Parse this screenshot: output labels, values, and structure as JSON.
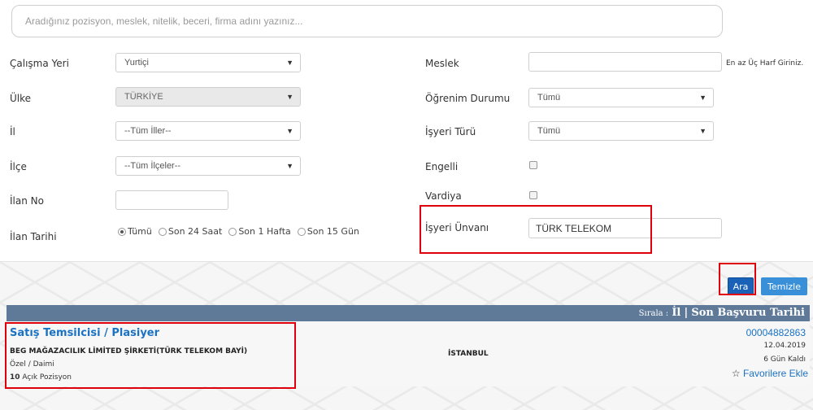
{
  "search": {
    "placeholder": "Aradığınız pozisyon, meslek, nitelik, beceri, firma adını yazınız..."
  },
  "form": {
    "calisma_yeri": {
      "label": "Çalışma Yeri",
      "value": "Yurtiçi"
    },
    "ulke": {
      "label": "Ülke",
      "value": "TÜRKİYE"
    },
    "il": {
      "label": "İl",
      "value": "--Tüm İller--"
    },
    "ilce": {
      "label": "İlçe",
      "value": "--Tüm İlçeler--"
    },
    "ilan_no": {
      "label": "İlan No",
      "value": ""
    },
    "ilan_tarihi": {
      "label": "İlan Tarihi",
      "options": [
        "Tümü",
        "Son 24 Saat",
        "Son 1 Hafta",
        "Son 15 Gün"
      ],
      "selected": "Tümü"
    },
    "meslek": {
      "label": "Meslek",
      "value": "",
      "hint": "En az Üç Harf Giriniz."
    },
    "ogrenim_durumu": {
      "label": "Öğrenim Durumu",
      "value": "Tümü"
    },
    "isyeri_turu": {
      "label": "İşyeri Türü",
      "value": "Tümü"
    },
    "engelli": {
      "label": "Engelli",
      "checked": false
    },
    "vardiya": {
      "label": "Vardiya",
      "checked": false
    },
    "isyeri_unvani": {
      "label": "İşyeri Ünvanı",
      "value": "TÜRK TELEKOM"
    }
  },
  "buttons": {
    "ara": "Ara",
    "temizle": "Temizle"
  },
  "results_bar": {
    "sort_label": "Sırala :",
    "sort_il": "İl",
    "separator": "|",
    "sort_date": "Son Başvuru Tarihi"
  },
  "result": {
    "title": "Satış Temsilcisi / Plasiyer",
    "company": "BEG MAĞAZACILIK LİMİTED ŞİRKETİ(TÜRK TELEKOM BAYİ)",
    "type": "Özel / Daimi",
    "positions_count": "10",
    "positions_text": "Açık Pozisyon",
    "city": "İSTANBUL",
    "ilan_no": "00004882863",
    "date": "12.04.2019",
    "remaining": "6 Gün Kaldı",
    "favorite": "Favorilere Ekle"
  },
  "colors": {
    "accent": "#1b72c3",
    "highlight": "#e0000b",
    "results_bar": "#5f7a99"
  }
}
